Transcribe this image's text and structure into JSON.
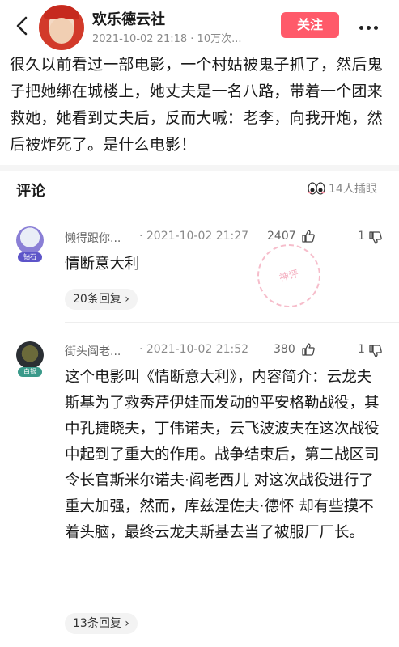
{
  "header": {
    "user_name": "欢乐德云社",
    "meta": "2021-10-02 21:18 · 10万次...",
    "follow_label": "关注",
    "avatar_text": "欢乐德云"
  },
  "post": {
    "text": "很久以前看过一部电影，一个村姑被鬼子抓了，然后鬼子把她绑在城楼上，她丈夫是一名八路，带着一个团来救她，她看到丈夫后，反而大喊：老李，向我开炮，然后被炸死了。是什么电影！"
  },
  "comments_section": {
    "title": "评论",
    "insert_label": "14人插眼"
  },
  "comments": [
    {
      "name": "懒得跟你...",
      "time": "· 2021-10-02 21:27",
      "likes": "2407",
      "dislikes": "1",
      "body": "情断意大利",
      "replies": "20条回复 ›",
      "badge": "钻石"
    },
    {
      "name": "街头阎老...",
      "time": "· 2021-10-02 21:52",
      "likes": "380",
      "dislikes": "1",
      "body": "这个电影叫《情断意大利》，内容简介：云龙夫斯基为了救秀芹伊娃而发动的平安格勒战役，其中孔捷晓夫，丁伟诺夫，云飞波波夫在这次战役中起到了重大的作用。战争结束后，第二战区司令长官斯米尔诺夫·阎老西儿 对这次战役进行了重大加强，然而，库兹涅佐夫·德怀 却有些摸不着头脑，最终云龙夫斯基去当了被服厂厂长。",
      "replies": "13条回复 ›",
      "badge": "白银"
    }
  ],
  "stamp_text": "神评",
  "colors": {
    "accent": "#ff5a6a"
  }
}
